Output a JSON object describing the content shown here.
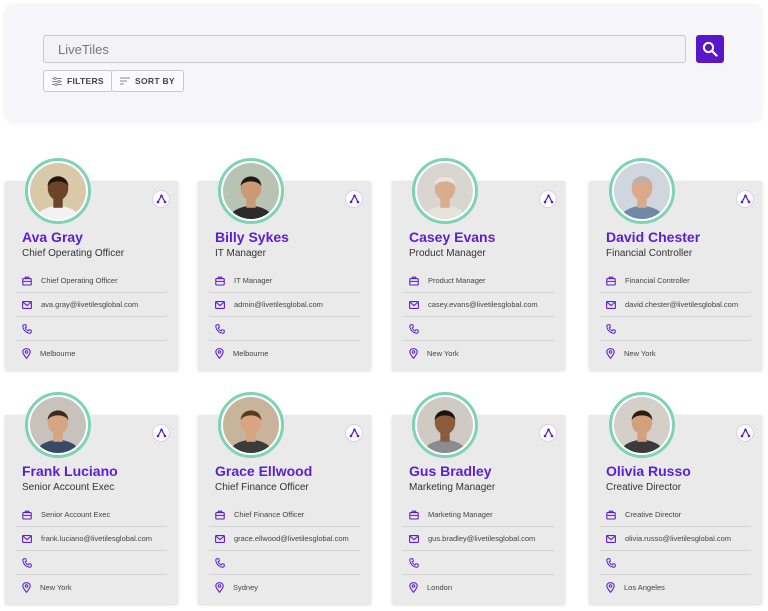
{
  "search": {
    "value": "LiveTiles"
  },
  "toolbar": {
    "filters_label": "FILTERS",
    "sort_label": "SORT BY"
  },
  "accent": "#5a17c9",
  "ring_color": "#7ed3b5",
  "people": [
    {
      "name": "Ava Gray",
      "title": "Chief Operating Officer",
      "department": "Chief Operating Officer",
      "email": "ava.gray@livetilesglobal.com",
      "phone": "",
      "location": "Melbourne"
    },
    {
      "name": "Billy Sykes",
      "title": "IT Manager",
      "department": "IT Manager",
      "email": "admin@livetilesglobal.com",
      "phone": "",
      "location": "Melbourne"
    },
    {
      "name": "Casey Evans",
      "title": "Product Manager",
      "department": "Product Manager",
      "email": "casey.evans@livetilesglobal.com",
      "phone": "",
      "location": "New York"
    },
    {
      "name": "David Chester",
      "title": "Financial Controller",
      "department": "Financial Controller",
      "email": "david.chester@livetilesglobal.com",
      "phone": "",
      "location": "New York"
    },
    {
      "name": "Frank Luciano",
      "title": "Senior Account Exec",
      "department": "Senior Account Exec",
      "email": "frank.luciano@livetilesglobal.com",
      "phone": "",
      "location": "New York"
    },
    {
      "name": "Grace Ellwood",
      "title": "Chief Finance Officer",
      "department": "Chief Finance Officer",
      "email": "grace.ellwood@livetilesglobal.com",
      "phone": "",
      "location": "Sydney"
    },
    {
      "name": "Gus Bradley",
      "title": "Marketing Manager",
      "department": "Marketing Manager",
      "email": "gus.bradley@livetilesglobal.com",
      "phone": "",
      "location": "London"
    },
    {
      "name": "Olivia Russo",
      "title": "Creative Director",
      "department": "Creative Director",
      "email": "olivia.russo@livetilesglobal.com",
      "phone": "",
      "location": "Los Angeles"
    }
  ]
}
